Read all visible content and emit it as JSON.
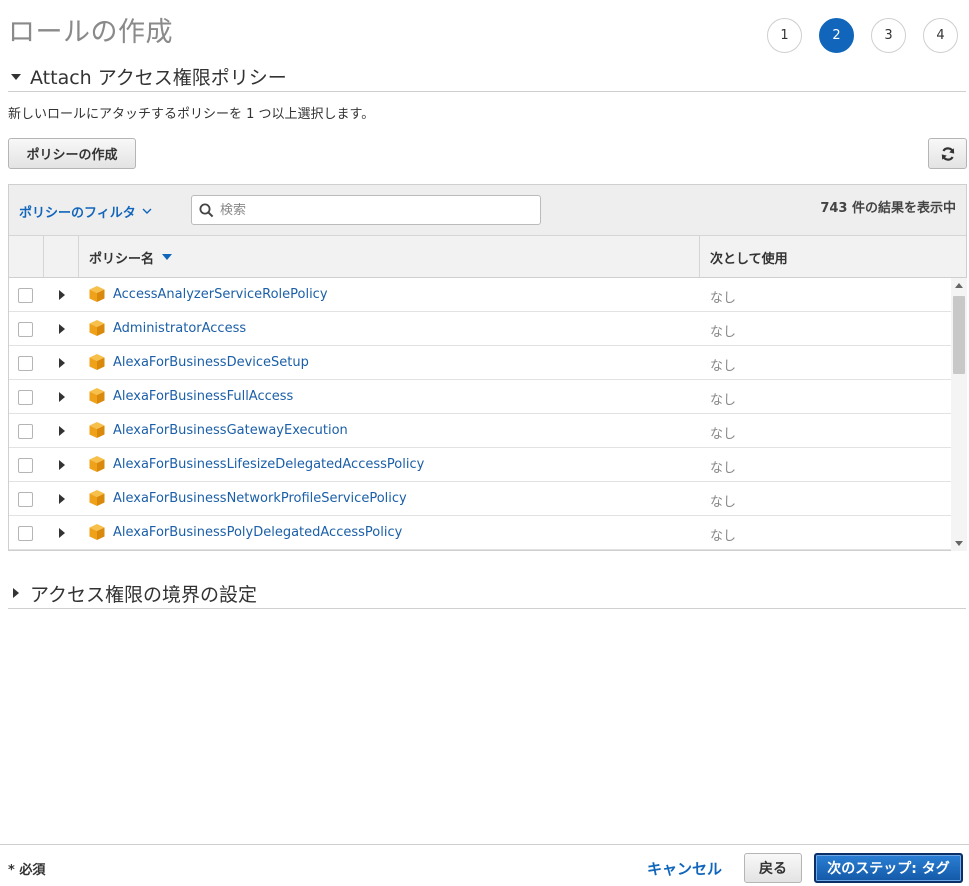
{
  "page": {
    "title": "ロールの作成",
    "steps": [
      "1",
      "2",
      "3",
      "4"
    ],
    "active_step": "2"
  },
  "attach_section": {
    "title": "Attach アクセス権限ポリシー",
    "description": "新しいロールにアタッチするポリシーを 1 つ以上選択します。",
    "create_policy_label": "ポリシーの作成",
    "refresh_icon": "refresh-icon"
  },
  "filter": {
    "label": "ポリシーのフィルタ",
    "search_placeholder": "検索",
    "result_count": "743 件の結果を表示中"
  },
  "table": {
    "columns": {
      "policy_name": "ポリシー名",
      "used_as": "次として使用"
    },
    "rows": [
      {
        "name": "AccessAnalyzerServiceRolePolicy",
        "used_as": "なし"
      },
      {
        "name": "AdministratorAccess",
        "used_as": "なし"
      },
      {
        "name": "AlexaForBusinessDeviceSetup",
        "used_as": "なし"
      },
      {
        "name": "AlexaForBusinessFullAccess",
        "used_as": "なし"
      },
      {
        "name": "AlexaForBusinessGatewayExecution",
        "used_as": "なし"
      },
      {
        "name": "AlexaForBusinessLifesizeDelegatedAccessPolicy",
        "used_as": "なし"
      },
      {
        "name": "AlexaForBusinessNetworkProfileServicePolicy",
        "used_as": "なし"
      },
      {
        "name": "AlexaForBusinessPolyDelegatedAccessPolicy",
        "used_as": "なし"
      }
    ]
  },
  "boundary_section": {
    "title": "アクセス権限の境界の設定"
  },
  "footer": {
    "required": "* 必須",
    "cancel": "キャンセル",
    "back": "戻る",
    "next": "次のステップ: タグ"
  },
  "colors": {
    "accent": "#1166bb",
    "link": "#1b5fa8",
    "policy_icon": "#f0a11a"
  }
}
